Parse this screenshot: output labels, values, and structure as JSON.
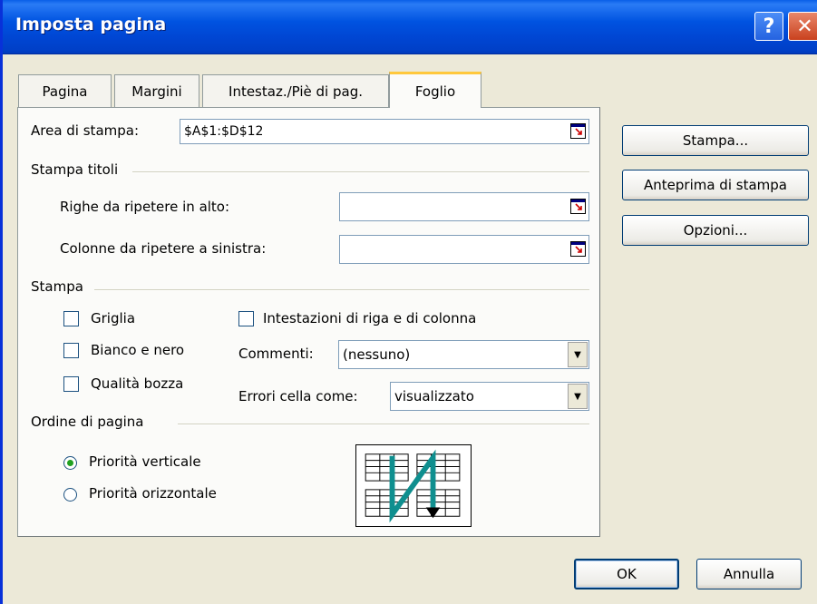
{
  "window": {
    "title": "Imposta pagina"
  },
  "tabs": [
    {
      "label": "Pagina"
    },
    {
      "label": "Margini"
    },
    {
      "label": "Intestaz./Piè di pag."
    },
    {
      "label": "Foglio"
    }
  ],
  "print_area": {
    "label": "Area di stampa:",
    "value": "$A$1:$D$12"
  },
  "print_titles": {
    "title": "Stampa titoli",
    "rows_label": "Righe da ripetere in alto:",
    "rows_value": "",
    "cols_label": "Colonne da ripetere a sinistra:",
    "cols_value": ""
  },
  "print": {
    "title": "Stampa",
    "gridlines": {
      "label": "Griglia",
      "checked": false
    },
    "black_white": {
      "label": "Bianco e nero",
      "checked": false
    },
    "draft_quality": {
      "label": "Qualità bozza",
      "checked": false
    },
    "row_col_headings": {
      "label": "Intestazioni di riga e di colonna",
      "checked": false
    },
    "comments": {
      "label": "Commenti:",
      "value": "(nessuno)"
    },
    "cell_errors": {
      "label": "Errori cella come:",
      "value": "visualizzato"
    }
  },
  "page_order": {
    "title": "Ordine di pagina",
    "down_then_over": {
      "label": "Priorità verticale",
      "selected": true
    },
    "over_then_down": {
      "label": "Priorità orizzontale",
      "selected": false
    }
  },
  "buttons": {
    "print": "Stampa...",
    "print_preview": "Anteprima di stampa",
    "options": "Opzioni...",
    "ok": "OK",
    "cancel": "Annulla"
  },
  "icons": {
    "help": "help-icon",
    "close": "close-icon",
    "collapse": "collapse-dialog-icon",
    "dropdown": "chevron-down-icon",
    "page_order_preview": "page-order-diagram"
  }
}
